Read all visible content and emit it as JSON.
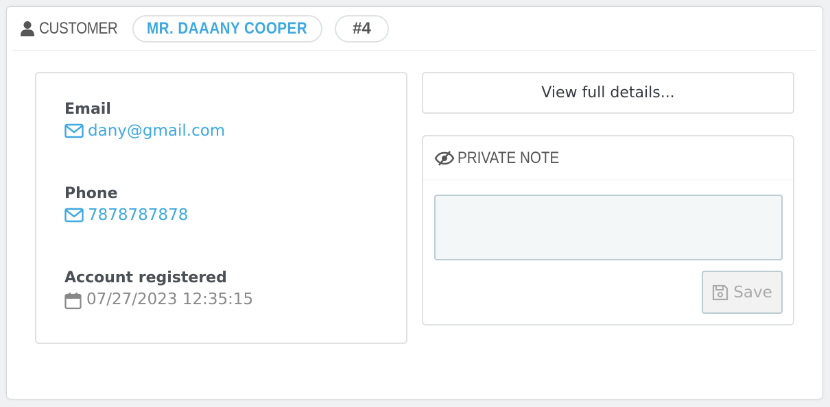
{
  "header": {
    "title": "Customer",
    "customer_name": "Mr. DAAANY COOPER",
    "customer_id": "#4",
    "icon": "user-icon"
  },
  "details": {
    "email_label": "Email",
    "email_value": "dany@gmail.com",
    "email_icon": "envelope-icon",
    "phone_label": "Phone",
    "phone_value": "7878787878",
    "phone_icon": "envelope-icon",
    "registered_label": "Account registered",
    "registered_value": "07/27/2023 12:35:15",
    "registered_icon": "calendar-icon"
  },
  "actions": {
    "view_details_label": "View full details..."
  },
  "private_note": {
    "title": "Private note",
    "icon": "eye-slash-icon",
    "textarea_value": "",
    "save_label": "Save",
    "save_icon": "floppy-disk-icon"
  },
  "colors": {
    "link": "#3ea9e0",
    "border": "#dfe1e3",
    "textarea_bg": "#f4f7f8"
  }
}
